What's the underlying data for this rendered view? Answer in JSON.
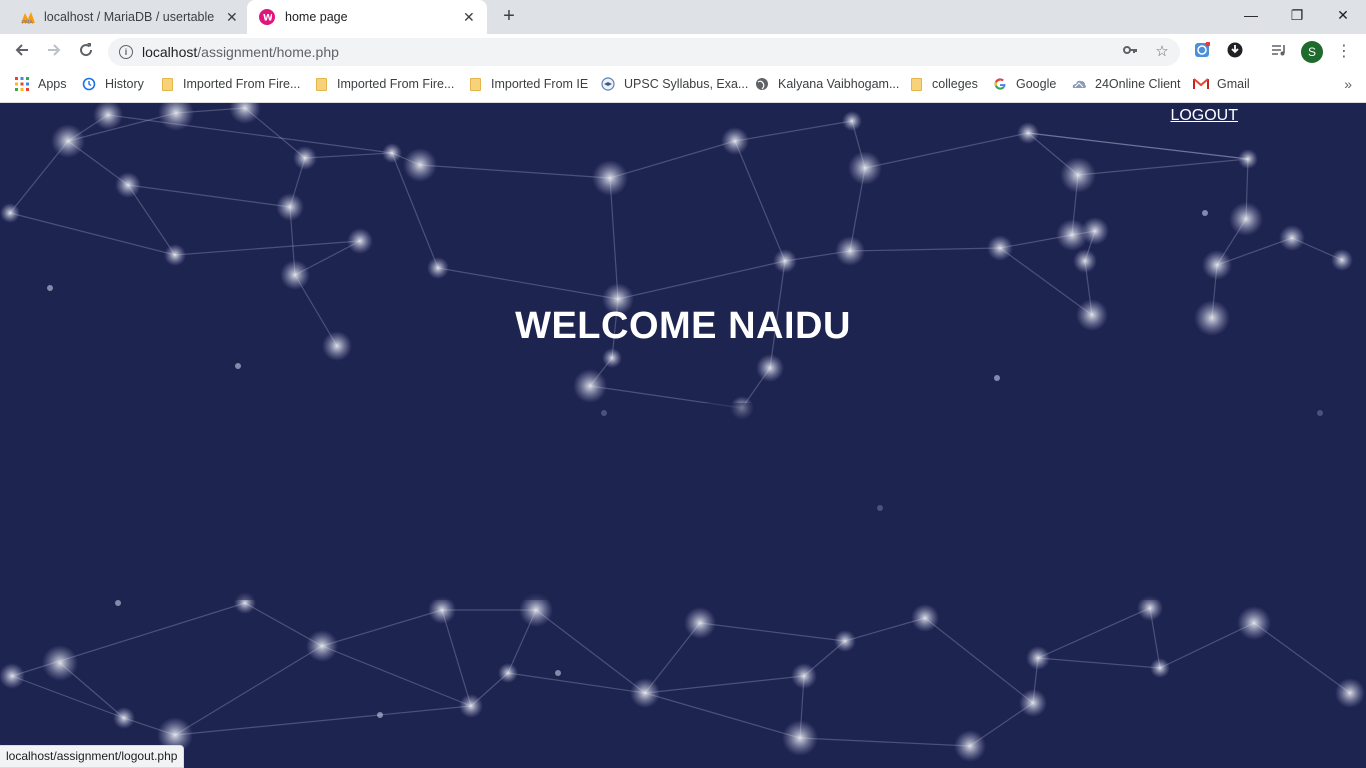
{
  "tabs": [
    {
      "title": "localhost / MariaDB / usertable /",
      "icon": "phpmyadmin-icon",
      "active": false
    },
    {
      "title": "home page",
      "icon": "wamp-icon",
      "active": true
    }
  ],
  "address_bar": {
    "host": "localhost",
    "path": "/assignment/home.php"
  },
  "bookmarks": [
    {
      "label": "Apps",
      "icon": "apps-grid-icon"
    },
    {
      "label": "History",
      "icon": "history-icon"
    },
    {
      "label": "Imported From Fire...",
      "icon": "folder-icon"
    },
    {
      "label": "Imported From Fire...",
      "icon": "folder-icon"
    },
    {
      "label": "Imported From IE",
      "icon": "folder-icon"
    },
    {
      "label": "UPSC Syllabus, Exa...",
      "icon": "upsc-icon"
    },
    {
      "label": "Kalyana Vaibhogam...",
      "icon": "globe-icon"
    },
    {
      "label": "colleges",
      "icon": "folder-icon"
    },
    {
      "label": "Google",
      "icon": "google-icon"
    },
    {
      "label": "24Online Client",
      "icon": "cloud-icon"
    },
    {
      "label": "Gmail",
      "icon": "gmail-icon"
    }
  ],
  "profile_initial": "S",
  "page": {
    "logout_label": "LOGOUT",
    "welcome_text": "WELCOME NAIDU",
    "background_color": "#1e2450"
  },
  "status_bar": {
    "url": "localhost/assignment/logout.php"
  }
}
